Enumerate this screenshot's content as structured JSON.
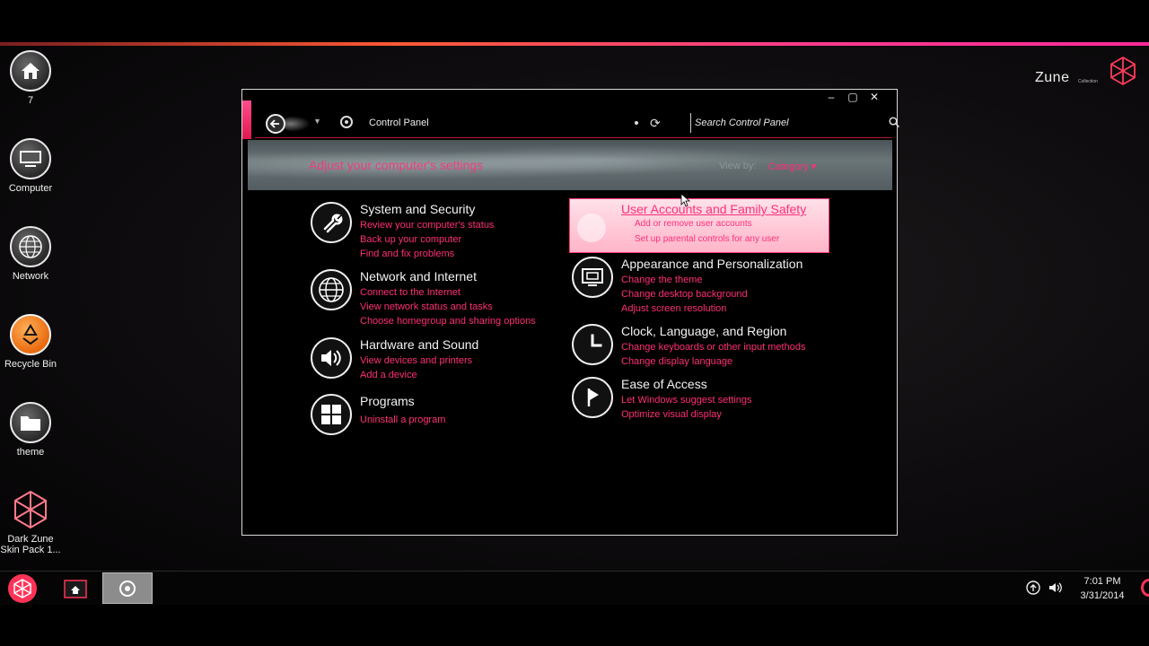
{
  "desktop": {
    "icons": [
      {
        "label": "7",
        "icon": "home-icon"
      },
      {
        "label": "Computer",
        "icon": "computer-icon"
      },
      {
        "label": "Network",
        "icon": "globe-icon"
      },
      {
        "label": "Recycle Bin",
        "icon": "recycle-icon"
      },
      {
        "label": "theme",
        "icon": "folder-icon"
      },
      {
        "label": "Dark Zune Skin Pack 1...",
        "icon": "zune-star-icon"
      }
    ],
    "logo_text": "Zune",
    "logo_sub": "Collection"
  },
  "window": {
    "address": "Control Panel",
    "search_placeholder": "Search Control Panel",
    "header_title": "Adjust your computer's settings",
    "view_by_label": "View by:",
    "view_by_value": "Category ▾",
    "categories_left": [
      {
        "title": "System and Security",
        "icon": "wrench-icon",
        "links": [
          "Review your computer's status",
          "Back up your computer",
          "Find and fix problems"
        ]
      },
      {
        "title": "Network and Internet",
        "icon": "globe-icon",
        "links": [
          "Connect to the Internet",
          "View network status and tasks",
          "Choose homegroup and sharing options"
        ]
      },
      {
        "title": "Hardware and Sound",
        "icon": "speaker-icon",
        "links": [
          "View devices and printers",
          "Add a device"
        ]
      },
      {
        "title": "Programs",
        "icon": "windows-grid-icon",
        "links": [
          "Uninstall a program"
        ]
      }
    ],
    "categories_right": [
      {
        "title": "User Accounts and Family Safety",
        "icon": "users-icon",
        "links": [
          "Add or remove user accounts",
          "Set up parental controls for any user"
        ]
      },
      {
        "title": "Appearance and Personalization",
        "icon": "monitor-icon",
        "links": [
          "Change the theme",
          "Change desktop background",
          "Adjust screen resolution"
        ]
      },
      {
        "title": "Clock, Language, and Region",
        "icon": "clock-icon",
        "links": [
          "Change keyboards or other input methods",
          "Change display language"
        ]
      },
      {
        "title": "Ease of Access",
        "icon": "flag-icon",
        "links": [
          "Let Windows suggest settings",
          "Optimize visual display"
        ]
      }
    ]
  },
  "taskbar": {
    "time": "7:01 PM",
    "date": "3/31/2014"
  },
  "colors": {
    "accent": "#ff2f7a",
    "start": "#ff3358"
  }
}
